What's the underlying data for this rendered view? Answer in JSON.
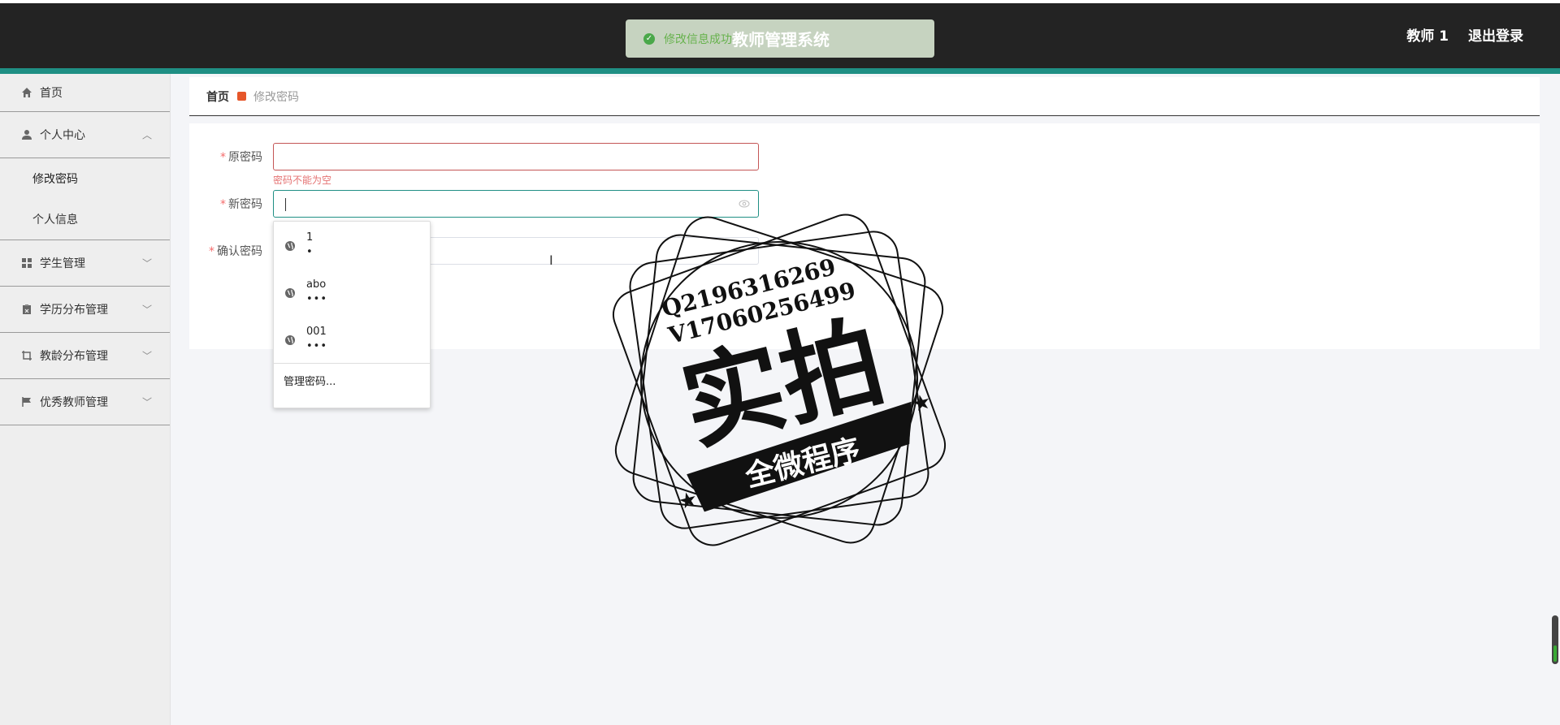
{
  "header": {
    "toast_message": "修改信息成功",
    "title": "教师管理系统",
    "user_name": "教师 1",
    "logout_label": "退出登录"
  },
  "sidebar": {
    "home_label": "首页",
    "personal_center": {
      "label": "个人中心",
      "children": [
        "修改密码",
        "个人信息"
      ]
    },
    "items": [
      {
        "label": "学生管理"
      },
      {
        "label": "学历分布管理"
      },
      {
        "label": "教龄分布管理"
      },
      {
        "label": "优秀教师管理"
      }
    ]
  },
  "breadcrumb": {
    "home": "首页",
    "current": "修改密码"
  },
  "form": {
    "old_password": {
      "label": "原密码",
      "value": "",
      "error": "密码不能为空"
    },
    "new_password": {
      "label": "新密码",
      "value": ""
    },
    "confirm_password": {
      "label": "确认密码",
      "value": ""
    }
  },
  "autocomplete": {
    "entries": [
      {
        "user": "1",
        "pass": "•"
      },
      {
        "user": "abo",
        "pass": "•••"
      },
      {
        "user": "001",
        "pass": "•••"
      }
    ],
    "manage_label": "管理密码..."
  },
  "watermark": {
    "contact_q": "Q2196316269",
    "contact_v": "V17060256499",
    "main_text": "实拍",
    "banner_text": "全微程序"
  },
  "colors": {
    "header_bg": "#232323",
    "accent_stripe": "#1f8f84",
    "error_red": "#e57373",
    "toast_bg": "#c6d3c0"
  }
}
